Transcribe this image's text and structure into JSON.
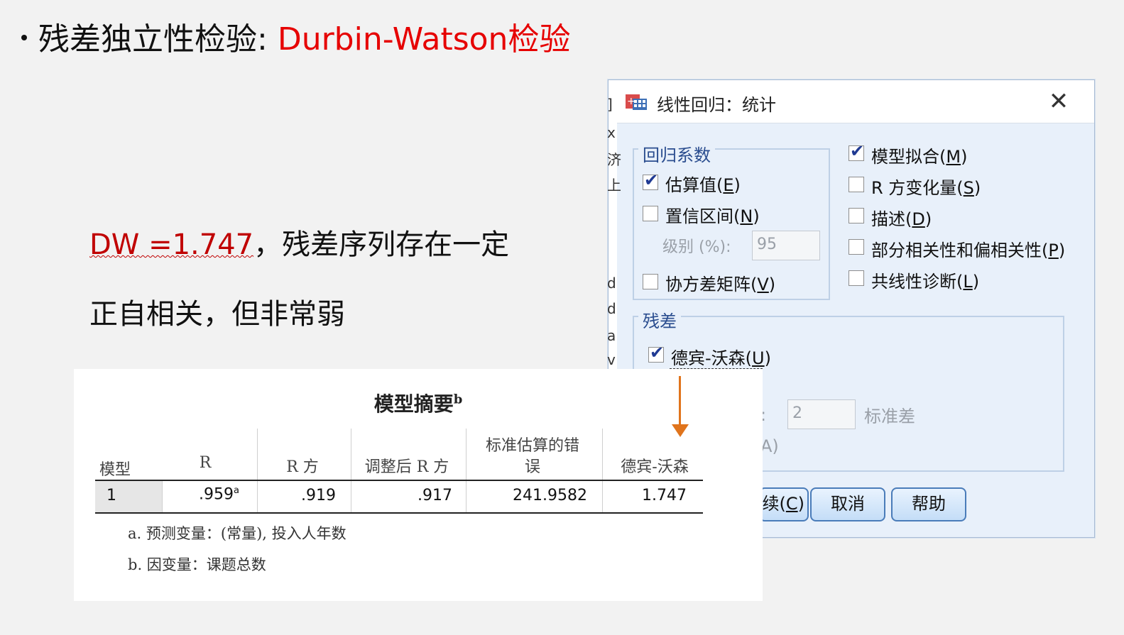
{
  "slide": {
    "heading_prefix": "残差独立性检验: ",
    "heading_highlight": "Durbin-Watson检验",
    "conclusion_dw": "DW =1.747",
    "conclusion_line1_rest": "，残差序列存在一定",
    "conclusion_line2": "正自相关，但非常弱"
  },
  "dialog": {
    "title": "线性回归：统计",
    "close_glyph": "✕",
    "left_strip_chars": [
      "]",
      "x",
      "济",
      "上",
      "d",
      "d",
      "a",
      "v"
    ],
    "coef_group": {
      "legend": "回归系数",
      "estimates": {
        "text": "估算值(",
        "key": "E",
        "end": ")",
        "checked": true
      },
      "conf_intervals": {
        "text": "置信区间(",
        "key": "N",
        "end": ")",
        "checked": false
      },
      "level_label": "级别 (%):",
      "level_value": "95",
      "covariance": {
        "text": "协方差矩阵(",
        "key": "V",
        "end": ")",
        "checked": false
      }
    },
    "right_options": [
      {
        "text": "模型拟合(",
        "key": "M",
        "end": ")",
        "checked": true
      },
      {
        "text": "R 方变化量(",
        "key": "S",
        "end": ")",
        "checked": false
      },
      {
        "text": "描述(",
        "key": "D",
        "end": ")",
        "checked": false
      },
      {
        "text": "部分相关性和偏相关性(",
        "key": "P",
        "end": ")",
        "checked": false
      },
      {
        "text": "共线性诊断(",
        "key": "L",
        "end": ")",
        "checked": false
      }
    ],
    "residual_group": {
      "legend": "残差",
      "durbin_watson": {
        "text": "德宾-沃森(",
        "key": "U",
        "end": ")",
        "checked": true
      },
      "outlier_colon": ":",
      "outlier_value": "2",
      "std_label": "标准差",
      "partial_a": "A)"
    },
    "buttons": {
      "continue_partial": "续(",
      "continue_key": "C",
      "continue_end": ")",
      "cancel": "取消",
      "help": "帮助"
    }
  },
  "model_summary": {
    "title": "模型摘要",
    "title_sup": "b",
    "headers": [
      "模型",
      "R",
      "R 方",
      "调整后 R 方",
      "标准估算的错",
      "误",
      "德宾-沃森"
    ],
    "row": {
      "model": "1",
      "r": ".959",
      "r_sup": "a",
      "r_square": ".919",
      "adj_r_square": ".917",
      "std_error": "241.9582",
      "durbin_watson": "1.747"
    },
    "footnote_a": "a. 预测变量：(常量), 投入人年数",
    "footnote_b": "b. 因变量：课题总数"
  },
  "colors": {
    "highlight_red": "#e60000",
    "dw_red": "#c00000",
    "arrow_orange": "#e0741c",
    "dialog_bg": "#e8f0fa",
    "legend_blue": "#2a4d8f"
  }
}
